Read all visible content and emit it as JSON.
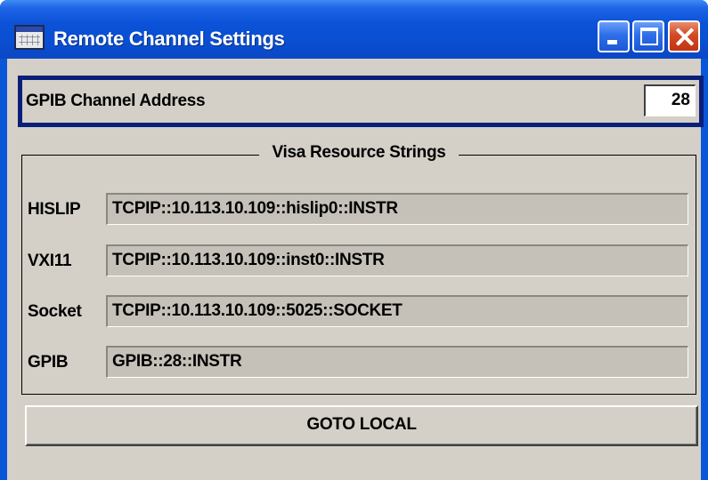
{
  "window": {
    "title": "Remote Channel Settings",
    "title_icon": "keyboard-app-icon",
    "controls": [
      "minimize-icon",
      "maximize-icon",
      "close-icon"
    ]
  },
  "gpib": {
    "label": "GPIB Channel Address",
    "address": "28"
  },
  "visa": {
    "group_title": "Visa Resource Strings",
    "rows": [
      {
        "label": "HISLIP",
        "value": "TCPIP::10.113.10.109::hislip0::INSTR"
      },
      {
        "label": "VXI11",
        "value": "TCPIP::10.113.10.109::inst0::INSTR"
      },
      {
        "label": "Socket",
        "value": "TCPIP::10.113.10.109::5025::SOCKET"
      },
      {
        "label": "GPIB",
        "value": "GPIB::28::INSTR"
      }
    ]
  },
  "actions": {
    "goto_local": "GOTO LOCAL"
  },
  "colors": {
    "titlebar": "#0a52d8",
    "client_bg": "#d4d0c8",
    "focus_border": "#0a1f7a",
    "close_button": "#c23512"
  }
}
